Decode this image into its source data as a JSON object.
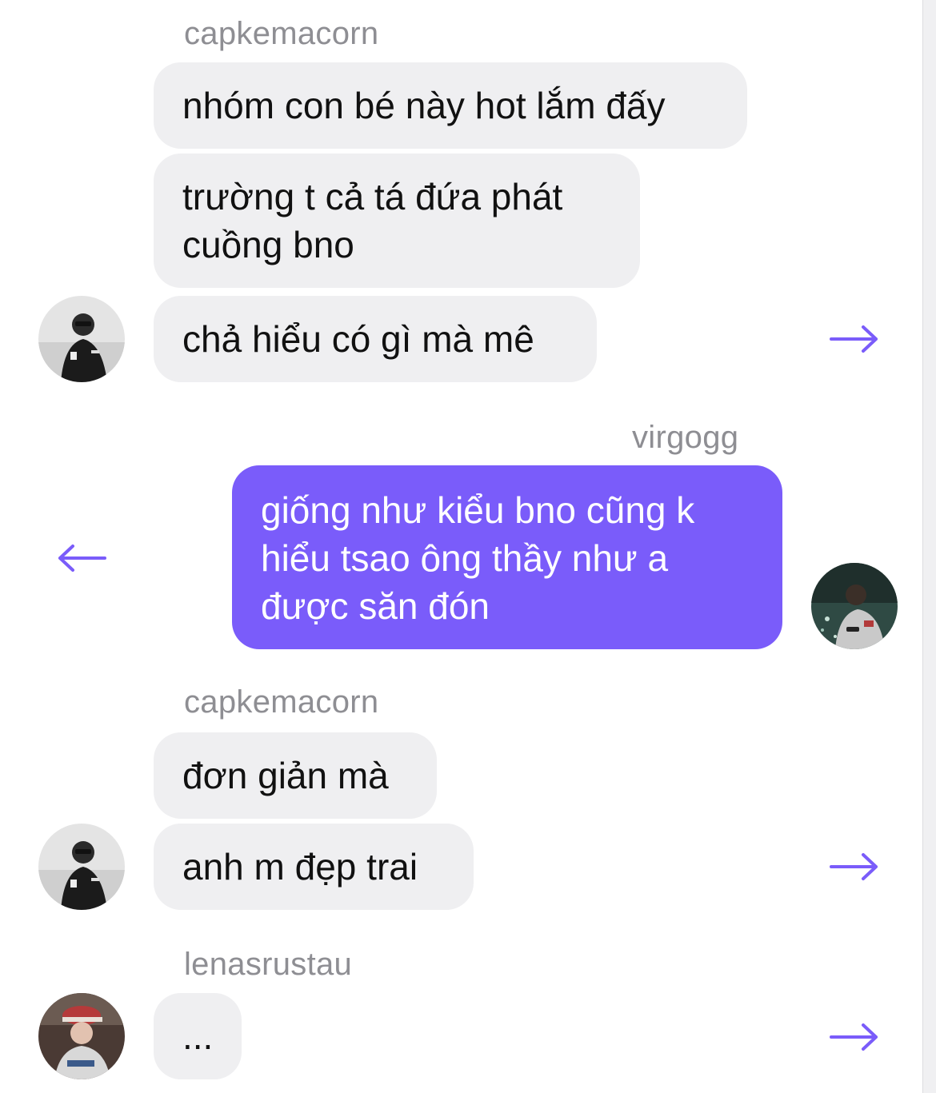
{
  "colors": {
    "outgoing_bubble": "#7a5cfa",
    "incoming_bubble": "#efeff1",
    "sender_name": "#8e8e93",
    "reply_arrow": "#7a5cfa"
  },
  "icons": {
    "reply_forward": "arrow-right-icon",
    "reply_back": "arrow-left-icon"
  },
  "messages": {
    "group1": {
      "sender": "capkemacorn",
      "bubbles": [
        "nhóm con bé này hot lắm đấy",
        "trường t cả tá đứa phát cuồng bno",
        "chả hiểu có gì mà mê"
      ]
    },
    "group2": {
      "sender": "virgogg",
      "bubbles": [
        "giống như kiểu bno cũng k hiểu tsao ông thầy như a được săn đón"
      ]
    },
    "group3": {
      "sender": "capkemacorn",
      "bubbles": [
        "đơn giản mà",
        "anh m đẹp trai"
      ]
    },
    "group4": {
      "sender": "lenasrustau",
      "bubbles": [
        "..."
      ]
    }
  }
}
